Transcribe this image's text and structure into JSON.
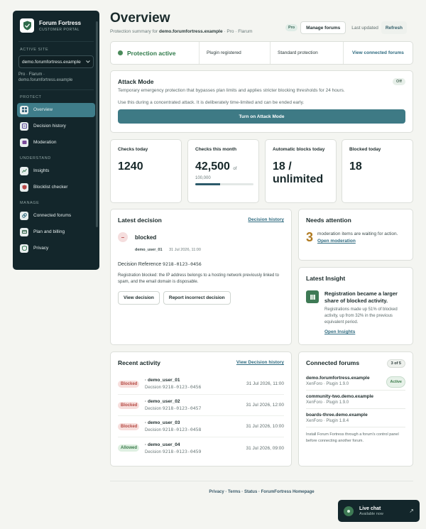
{
  "brand": {
    "name": "Forum Fortress",
    "subtitle": "CUSTOMER PORTAL"
  },
  "sidebar": {
    "active_site_label": "ACTIVE SITE",
    "site_value": "demo.forumfortress.example",
    "site_meta_line1": "Pro · Flarum ·",
    "site_meta_line2": "demo.forumfortress.example",
    "sections": [
      {
        "label": "PROTECT",
        "items": [
          "Overview",
          "Decision history",
          "Moderation"
        ]
      },
      {
        "label": "UNDERSTAND",
        "items": [
          "Insights",
          "Blocklist checker"
        ]
      },
      {
        "label": "MANAGE",
        "items": [
          "Connected forums",
          "Plan and billing",
          "Privacy"
        ]
      }
    ]
  },
  "header": {
    "title": "Overview",
    "subtitle_prefix": "Protection summary for",
    "subtitle_site": "demo.forumfortress.example",
    "subtitle_suffix": "· Pro · Flarum",
    "plan_badge": "Pro",
    "manage_label": "Manage forums",
    "last_updated_label": "Last updated",
    "refresh_label": "Refresh"
  },
  "status": {
    "active": "Protection active",
    "plugin": "Plugin registered",
    "level": "Standard protection",
    "link": "View connected forums"
  },
  "attack": {
    "title": "Attack Mode",
    "badge": "Off",
    "desc": "Temporary emergency protection that bypasses plan limits and applies stricter blocking thresholds for 24 hours.",
    "note": "Use this during a concentrated attack. It is deliberately time-limited and can be ended early.",
    "button": "Turn on Attack Mode"
  },
  "stats": {
    "checks_today_label": "Checks today",
    "checks_today_value": "1240",
    "checks_month_label": "Checks this month",
    "checks_month_value": "42,500",
    "checks_month_of": "of",
    "checks_month_limit": "100,000",
    "checks_month_fraction": 0.425,
    "auto_blocks_label": "Automatic blocks today",
    "auto_blocks_value": "18 / unlimited",
    "blocked_today_label": "Blocked today",
    "blocked_today_value": "18"
  },
  "latest": {
    "title": "Latest decision",
    "link": "Decision history",
    "status": "blocked",
    "user": "demo_user_01",
    "date": "31 Jul 2026, 11:00",
    "ref_label": "Decision Reference",
    "ref_value": "9218-0123-0456",
    "text": "Registration blocked: the IP address belongs to a hosting network previously linked to spam, and the email domain is disposable.",
    "btn_view": "View decision",
    "btn_report": "Report incorrect decision"
  },
  "needs": {
    "title": "Needs attention",
    "count": "3",
    "text": "moderation items are waiting for action.",
    "link": "Open moderation"
  },
  "insight": {
    "title": "Latest Insight",
    "head": "Registration became a larger share of blocked activity.",
    "desc": "Registrations made up 51% of blocked activity, up from 32% in the previous equivalent period.",
    "link": "Open Insights"
  },
  "recent": {
    "title": "Recent activity",
    "link": "View Decision history",
    "rows": [
      {
        "status": "Blocked",
        "user": "demo_user_01",
        "decision": "9218-0123-0456",
        "date": "31 Jul 2026, 11:00"
      },
      {
        "status": "Blocked",
        "user": "demo_user_02",
        "decision": "9218-0123-0457",
        "date": "31 Jul 2026, 12:00"
      },
      {
        "status": "Blocked",
        "user": "demo_user_03",
        "decision": "9218-0123-0458",
        "date": "31 Jul 2026, 10:00"
      },
      {
        "status": "Allowed",
        "user": "demo_user_04",
        "decision": "9218-0123-0459",
        "date": "31 Jul 2026, 09:00"
      }
    ],
    "decision_label": "Decision"
  },
  "forums": {
    "title": "Connected forums",
    "count": "3 of 5",
    "active_badge": "Active",
    "items": [
      {
        "name": "demo.forumfortress.example",
        "version": "XenForo · Plugin 1.9.0"
      },
      {
        "name": "community-two.demo.example",
        "version": "XenForo · Plugin 1.9.0"
      },
      {
        "name": "boards-three.demo.example",
        "version": "XenForo · Plugin 1.8.4"
      }
    ],
    "note": "Install Forum Fortress through a forum's control panel before connecting another forum."
  },
  "footer": {
    "text": "Privacy · Terms · Status · ForumFortress Homepage"
  },
  "chat": {
    "title": "Live chat",
    "sub": "Available now"
  },
  "colors": {
    "sidebar_bg": "#13262b",
    "accent": "#3e7a85",
    "success": "#2f7a4a",
    "danger": "#b54a44"
  }
}
